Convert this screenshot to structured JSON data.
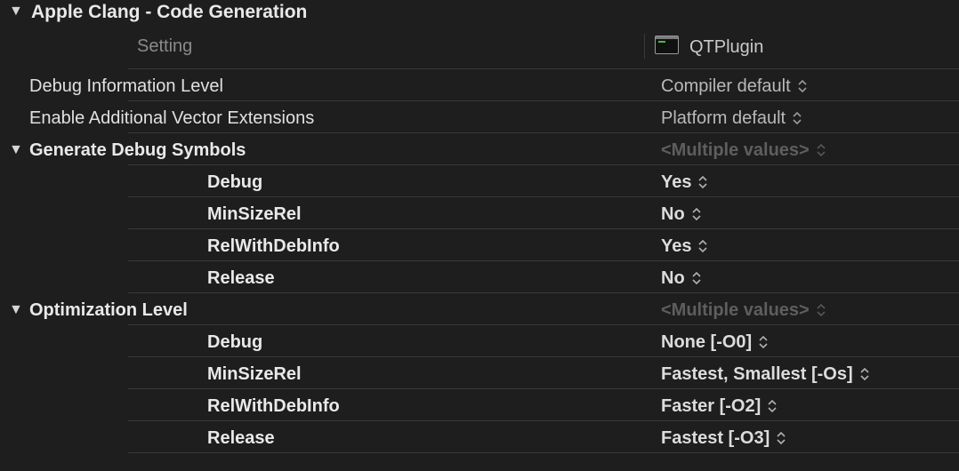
{
  "section": {
    "title": "Apple Clang - Code Generation",
    "setting_header": "Setting",
    "target_name": "QTPlugin",
    "target_icon": "terminal-app-icon"
  },
  "rows": {
    "debug_info_level": {
      "label": "Debug Information Level",
      "value": "Compiler default"
    },
    "vector_ext": {
      "label": "Enable Additional Vector Extensions",
      "value": "Platform default"
    },
    "gen_debug": {
      "label": "Generate Debug Symbols",
      "value": "<Multiple values>",
      "configs": [
        {
          "label": "Debug",
          "value": "Yes"
        },
        {
          "label": "MinSizeRel",
          "value": "No"
        },
        {
          "label": "RelWithDebInfo",
          "value": "Yes"
        },
        {
          "label": "Release",
          "value": "No"
        }
      ]
    },
    "opt_level": {
      "label": "Optimization Level",
      "value": "<Multiple values>",
      "configs": [
        {
          "label": "Debug",
          "value": "None [-O0]"
        },
        {
          "label": "MinSizeRel",
          "value": "Fastest, Smallest [-Os]"
        },
        {
          "label": "RelWithDebInfo",
          "value": "Faster [-O2]"
        },
        {
          "label": "Release",
          "value": "Fastest [-O3]"
        }
      ]
    }
  }
}
